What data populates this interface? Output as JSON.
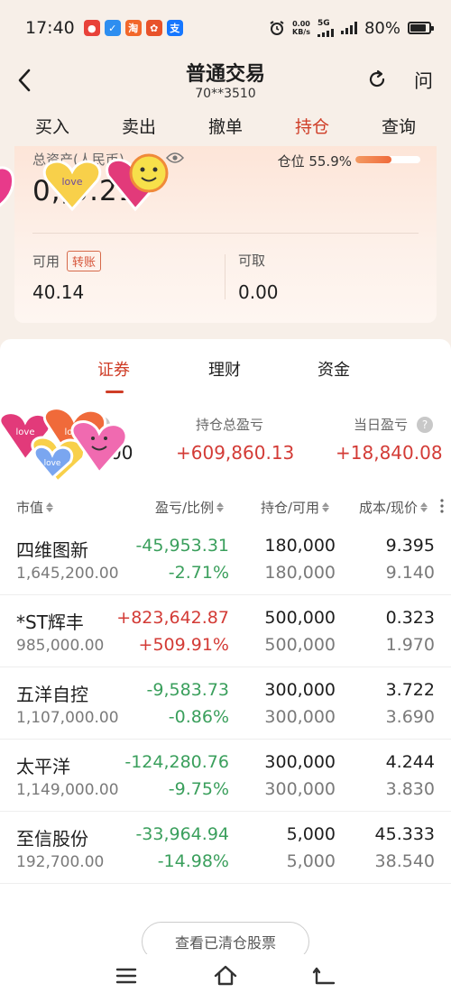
{
  "status_bar": {
    "time": "17:40",
    "net_speed_value": "0.00",
    "net_speed_unit": "KB/s",
    "network": "5G",
    "battery": "80%"
  },
  "header": {
    "title": "普通交易",
    "account": "70**3510",
    "ask_label": "问"
  },
  "tabs": [
    "买入",
    "卖出",
    "撤单",
    "持仓",
    "查询"
  ],
  "asset_card": {
    "total_label_visible": "总资产(人民币)",
    "position_ratio": "仓位 55.9%",
    "position_fraction": 0.559,
    "total_visible": "0,,0.21",
    "available_label": "可用",
    "transfer_label": "转账",
    "available_value": "40.14",
    "withdrawable_label": "可取",
    "withdrawable_value": "0.00"
  },
  "subtabs": [
    "证券",
    "理财",
    "资金"
  ],
  "summary": {
    "market_value_label": "",
    "market_value": "00",
    "total_pl_label": "持仓总盈亏",
    "total_pl": "+609,860.13",
    "daily_pl_label": "当日盈亏",
    "daily_pl": "+18,840.08"
  },
  "columns": [
    "市值",
    "盈亏/比例",
    "持仓/可用",
    "成本/现价"
  ],
  "holdings": [
    {
      "name": "四维图新",
      "market_value": "1,645,200.00",
      "pl": "-45,953.31",
      "pl_ratio": "-2.71%",
      "hold": "180,000",
      "avail": "180,000",
      "cost": "9.395",
      "price": "9.140",
      "dir": "green"
    },
    {
      "name": "*ST辉丰",
      "market_value": "985,000.00",
      "pl": "+823,642.87",
      "pl_ratio": "+509.91%",
      "hold": "500,000",
      "avail": "500,000",
      "cost": "0.323",
      "price": "1.970",
      "dir": "red"
    },
    {
      "name": "五洋自控",
      "market_value": "1,107,000.00",
      "pl": "-9,583.73",
      "pl_ratio": "-0.86%",
      "hold": "300,000",
      "avail": "300,000",
      "cost": "3.722",
      "price": "3.690",
      "dir": "green"
    },
    {
      "name": "太平洋",
      "market_value": "1,149,000.00",
      "pl": "-124,280.76",
      "pl_ratio": "-9.75%",
      "hold": "300,000",
      "avail": "300,000",
      "cost": "4.244",
      "price": "3.830",
      "dir": "green"
    },
    {
      "name": "至信股份",
      "market_value": "192,700.00",
      "pl": "-33,964.94",
      "pl_ratio": "-14.98%",
      "hold": "5,000",
      "avail": "5,000",
      "cost": "45.333",
      "price": "38.540",
      "dir": "green"
    }
  ],
  "cleared_button": "查看已清仓股票",
  "sticker_text": [
    "love",
    "love",
    "love",
    "love",
    "love"
  ],
  "colors": {
    "accent": "#cf3d27",
    "gain": "#d33b36",
    "loss": "#3a9f5c"
  }
}
